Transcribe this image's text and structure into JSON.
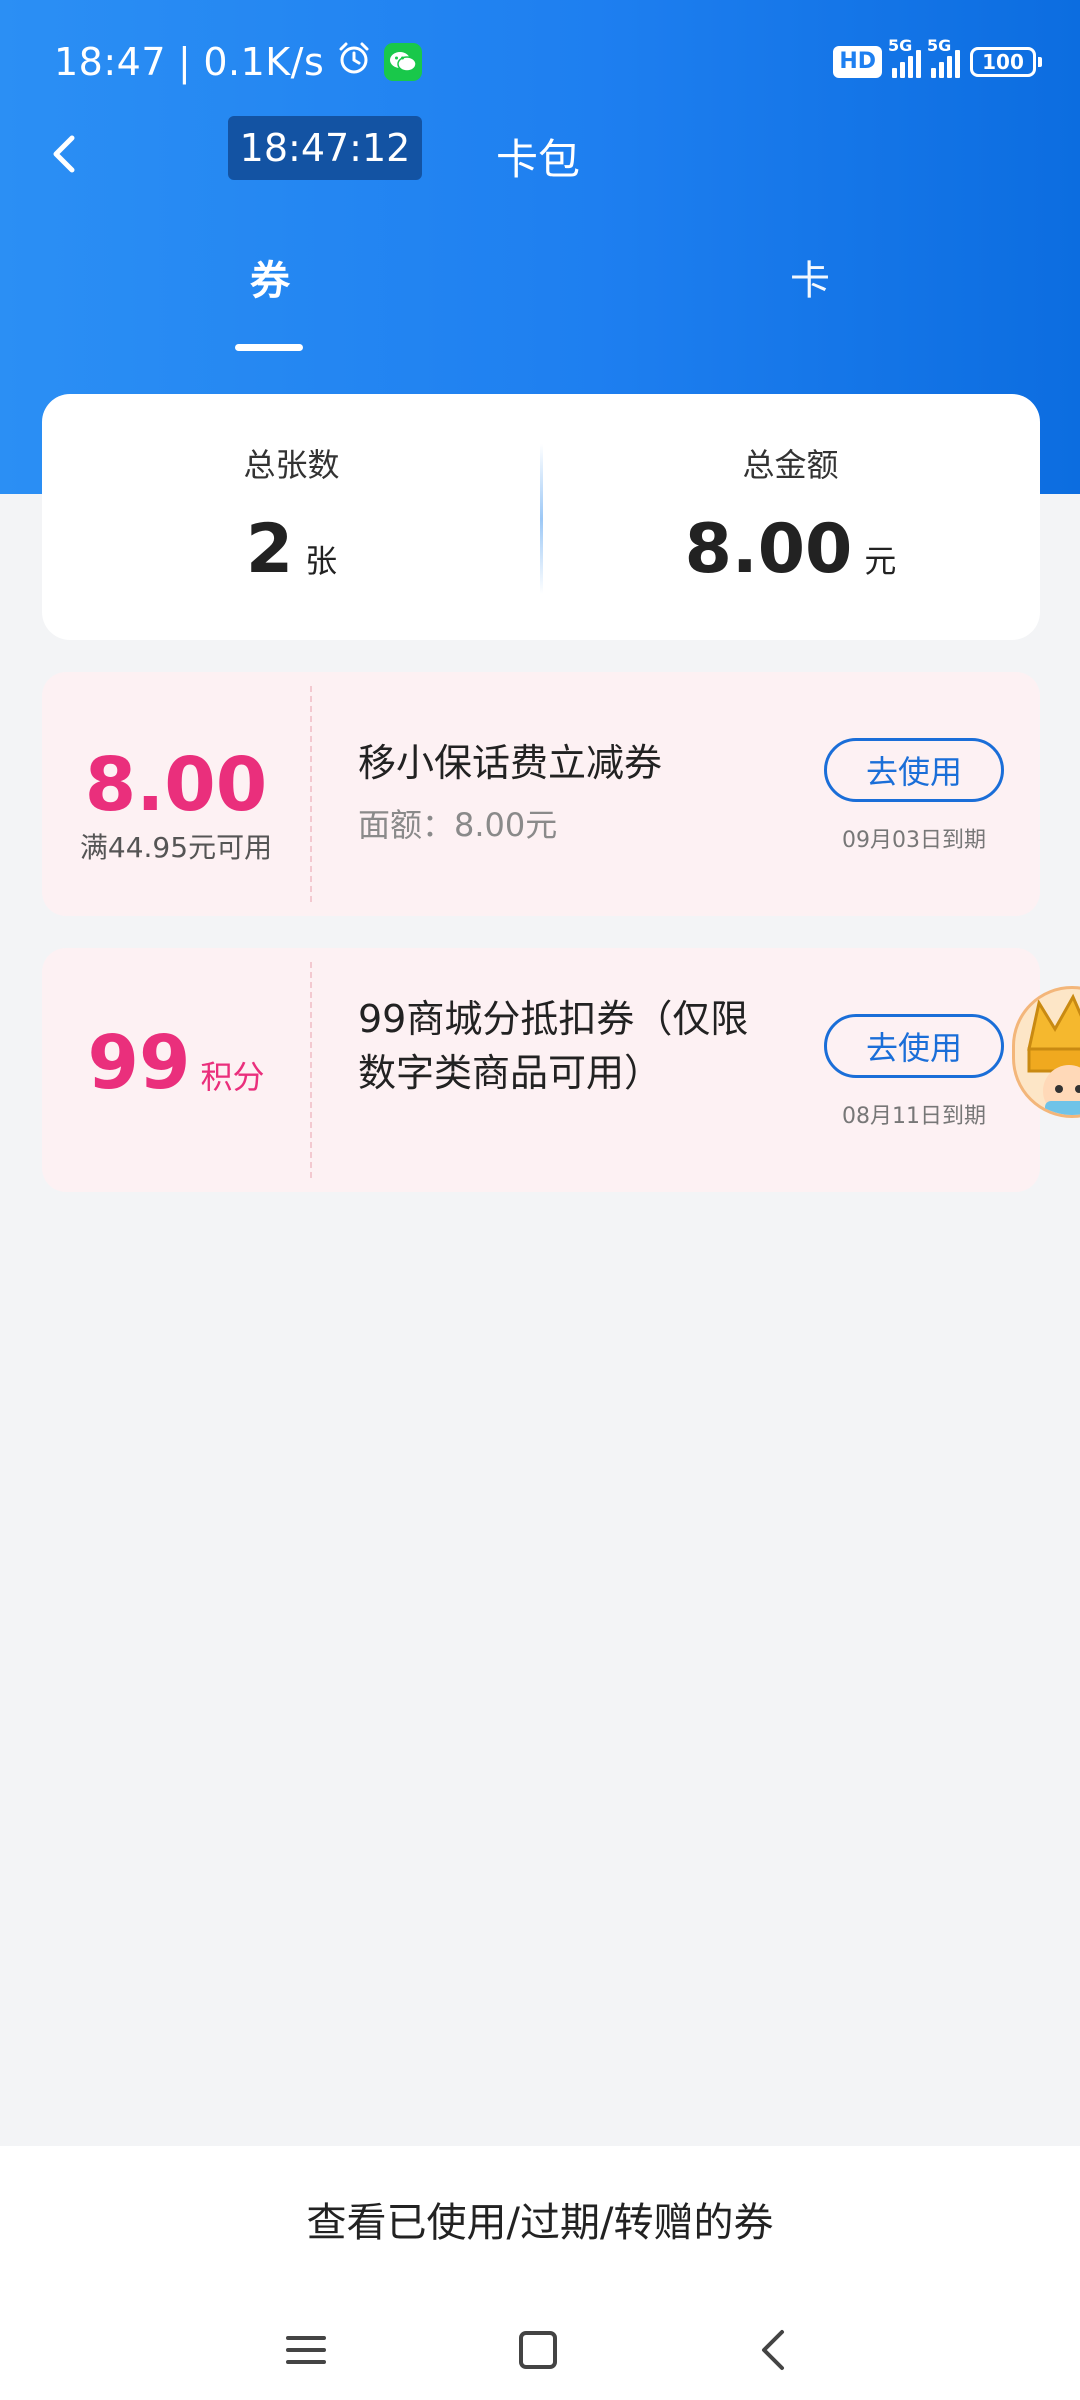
{
  "status_bar": {
    "time": "18:47",
    "net_speed": "0.1K/s",
    "hd_label": "HD",
    "sim1": "5G",
    "sim2": "5G",
    "battery": "100"
  },
  "nav": {
    "time_chip": "18:47:12",
    "title": "卡包"
  },
  "tabs": [
    {
      "label": "券",
      "active": true
    },
    {
      "label": "卡",
      "active": false
    }
  ],
  "summary": {
    "count_label": "总张数",
    "count_value": "2",
    "count_unit": "张",
    "amount_label": "总金额",
    "amount_value": "8.00",
    "amount_unit": "元"
  },
  "coupons": [
    {
      "amount": "8.00",
      "condition": "满44.95元可用",
      "title": "移小保话费立减券",
      "subtitle": "面额：8.00元",
      "button": "去使用",
      "expire": "09月03日到期"
    },
    {
      "amount": "99",
      "amount_unit": "积分",
      "title": "99商城分抵扣券（仅限数字类商品可用）",
      "button": "去使用",
      "expire": "08月11日到期"
    }
  ],
  "footer": {
    "history_link": "查看已使用/过期/转赠的券"
  },
  "colors": {
    "header_blue": "#1e7ff0",
    "accent_pink": "#ea2f7c",
    "button_blue": "#1a6ed8",
    "coupon_bg": "#fdf1f3"
  }
}
